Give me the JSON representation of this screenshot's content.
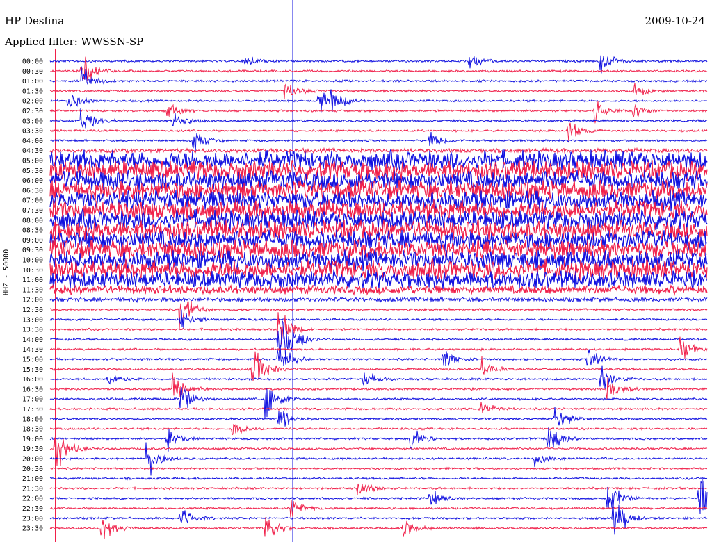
{
  "header": {
    "station": "HP Desfina",
    "date": "2009-10-24",
    "filter": "Applied filter: WWSSN-SP"
  },
  "axis": {
    "ylabel": "HHZ - 50000"
  },
  "chart_data": {
    "type": "line",
    "title": "",
    "xlabel": "",
    "ylabel": "HHZ - 50000",
    "row_labels": [
      "00:00",
      "00:30",
      "01:00",
      "01:30",
      "02:00",
      "02:30",
      "03:00",
      "03:30",
      "04:00",
      "04:30",
      "05:00",
      "05:30",
      "06:00",
      "06:30",
      "07:00",
      "07:30",
      "08:00",
      "08:30",
      "09:00",
      "09:30",
      "10:00",
      "10:30",
      "11:00",
      "11:30",
      "12:00",
      "12:30",
      "13:00",
      "13:30",
      "14:00",
      "14:30",
      "15:00",
      "15:30",
      "16:00",
      "16:30",
      "17:00",
      "17:30",
      "18:00",
      "18:30",
      "19:00",
      "19:30",
      "20:00",
      "20:30",
      "21:00",
      "21:30",
      "22:00",
      "22:30",
      "23:00",
      "23:30"
    ],
    "row_amplitude": [
      1,
      1,
      1,
      1,
      1,
      1,
      1,
      1,
      1,
      2,
      9,
      9,
      9,
      9,
      9,
      9,
      9,
      9,
      9,
      9,
      9,
      9,
      8,
      4,
      2,
      1,
      1,
      1,
      1,
      1,
      1,
      1,
      1,
      1,
      1,
      1,
      1,
      1,
      1,
      1,
      1,
      1,
      1,
      1,
      1,
      1,
      1,
      1
    ],
    "colors": [
      "#1010e0",
      "#f0204a"
    ],
    "events": [
      {
        "row": 0,
        "t": 0.3,
        "a": 6
      },
      {
        "row": 0,
        "t": 0.64,
        "a": 10
      },
      {
        "row": 0,
        "t": 0.84,
        "a": 14
      },
      {
        "row": 1,
        "t": 0.05,
        "a": 22
      },
      {
        "row": 2,
        "t": 0.05,
        "a": 18
      },
      {
        "row": 3,
        "t": 0.36,
        "a": 12
      },
      {
        "row": 3,
        "t": 0.89,
        "a": 10
      },
      {
        "row": 4,
        "t": 0.03,
        "a": 12
      },
      {
        "row": 4,
        "t": 0.41,
        "a": 16
      },
      {
        "row": 4,
        "t": 0.43,
        "a": 14
      },
      {
        "row": 5,
        "t": 0.18,
        "a": 10
      },
      {
        "row": 5,
        "t": 0.83,
        "a": 14
      },
      {
        "row": 5,
        "t": 0.89,
        "a": 10
      },
      {
        "row": 6,
        "t": 0.05,
        "a": 16
      },
      {
        "row": 6,
        "t": 0.19,
        "a": 12
      },
      {
        "row": 7,
        "t": 0.79,
        "a": 16
      },
      {
        "row": 8,
        "t": 0.22,
        "a": 14
      },
      {
        "row": 8,
        "t": 0.58,
        "a": 10
      },
      {
        "row": 25,
        "t": 0.2,
        "a": 26
      },
      {
        "row": 26,
        "t": 0.2,
        "a": 18
      },
      {
        "row": 27,
        "t": 0.35,
        "a": 24
      },
      {
        "row": 28,
        "t": 0.35,
        "a": 34
      },
      {
        "row": 28,
        "t": 0.36,
        "a": 20
      },
      {
        "row": 29,
        "t": 0.96,
        "a": 16
      },
      {
        "row": 30,
        "t": 0.35,
        "a": 20
      },
      {
        "row": 30,
        "t": 0.6,
        "a": 16
      },
      {
        "row": 30,
        "t": 0.82,
        "a": 18
      },
      {
        "row": 31,
        "t": 0.31,
        "a": 36
      },
      {
        "row": 31,
        "t": 0.66,
        "a": 14
      },
      {
        "row": 32,
        "t": 0.09,
        "a": 10
      },
      {
        "row": 32,
        "t": 0.48,
        "a": 10
      },
      {
        "row": 32,
        "t": 0.84,
        "a": 18
      },
      {
        "row": 33,
        "t": 0.19,
        "a": 20
      },
      {
        "row": 33,
        "t": 0.85,
        "a": 16
      },
      {
        "row": 34,
        "t": 0.2,
        "a": 22
      },
      {
        "row": 34,
        "t": 0.33,
        "a": 26
      },
      {
        "row": 35,
        "t": 0.66,
        "a": 10
      },
      {
        "row": 36,
        "t": 0.35,
        "a": 14
      },
      {
        "row": 36,
        "t": 0.77,
        "a": 22
      },
      {
        "row": 37,
        "t": 0.28,
        "a": 10
      },
      {
        "row": 38,
        "t": 0.18,
        "a": 14
      },
      {
        "row": 38,
        "t": 0.55,
        "a": 14
      },
      {
        "row": 38,
        "t": 0.76,
        "a": 22
      },
      {
        "row": 39,
        "t": 0.01,
        "a": 30
      },
      {
        "row": 40,
        "t": 0.15,
        "a": 22
      },
      {
        "row": 40,
        "t": 0.74,
        "a": 10
      },
      {
        "row": 43,
        "t": 0.47,
        "a": 14
      },
      {
        "row": 44,
        "t": 0.58,
        "a": 12
      },
      {
        "row": 44,
        "t": 0.85,
        "a": 24
      },
      {
        "row": 44,
        "t": 0.99,
        "a": 30
      },
      {
        "row": 45,
        "t": 0.37,
        "a": 12
      },
      {
        "row": 46,
        "t": 0.2,
        "a": 14
      },
      {
        "row": 46,
        "t": 0.86,
        "a": 30
      },
      {
        "row": 47,
        "t": 0.08,
        "a": 20
      },
      {
        "row": 47,
        "t": 0.33,
        "a": 18
      },
      {
        "row": 47,
        "t": 0.54,
        "a": 12
      }
    ]
  }
}
